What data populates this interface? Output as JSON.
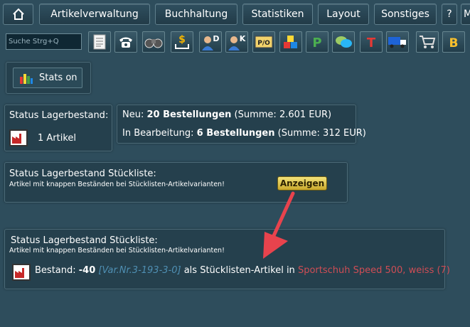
{
  "topnav": {
    "home_label": "⌂",
    "items": [
      {
        "label": "Artikelverwaltung"
      },
      {
        "label": "Buchhaltung"
      },
      {
        "label": "Statistiken"
      },
      {
        "label": "Layout"
      },
      {
        "label": "Sonstiges"
      },
      {
        "label": "?"
      },
      {
        "label": "M"
      }
    ]
  },
  "toolbar": {
    "search_placeholder": "Suche Strg+Q",
    "icons": [
      "document-icon",
      "telephone-icon",
      "binoculars-icon",
      "dollar-import-icon",
      "customer-d-icon",
      "customer-k-icon",
      "po-icon",
      "cubes-icon",
      "p-icon",
      "chat-icon",
      "t-icon",
      "truck-icon",
      "cart-icon",
      "b-icon"
    ]
  },
  "stats_button": {
    "label": "Stats on"
  },
  "panel_lagerbestand": {
    "title": "Status Lagerbestand:",
    "count": "1 Artikel"
  },
  "panel_bestellungen": {
    "neu_prefix": "Neu: ",
    "neu_bold": "20 Bestellungen",
    "neu_suffix": " (Summe: 2.601 EUR)",
    "bearb_prefix": "In Bearbeitung: ",
    "bearb_bold": "6 Bestellungen",
    "bearb_suffix": " (Summe: 312 EUR)"
  },
  "panel_stueckliste1": {
    "title": "Status Lagerbestand Stückliste:",
    "subtitle": "Artikel mit knappen Beständen bei Stücklisten-Artikelvarianten!",
    "button": "Anzeigen"
  },
  "panel_stueckliste2": {
    "title": "Status Lagerbestand Stückliste:",
    "subtitle": "Artikel mit knappen Beständen bei Stücklisten-Artikelvarianten!",
    "bestand_label": "Bestand: ",
    "bestand_value": "-40",
    "variant": "[Var.Nr.3-193-3-0]",
    "middle_text": " als Stücklisten-Artikel in ",
    "product": "Sportschuh Speed 500, weiss (7)"
  },
  "colors": {
    "accent_arrow": "#e8434d",
    "variant": "#4f8fb3",
    "product": "#cf4d55",
    "button": "#e0c34c"
  }
}
